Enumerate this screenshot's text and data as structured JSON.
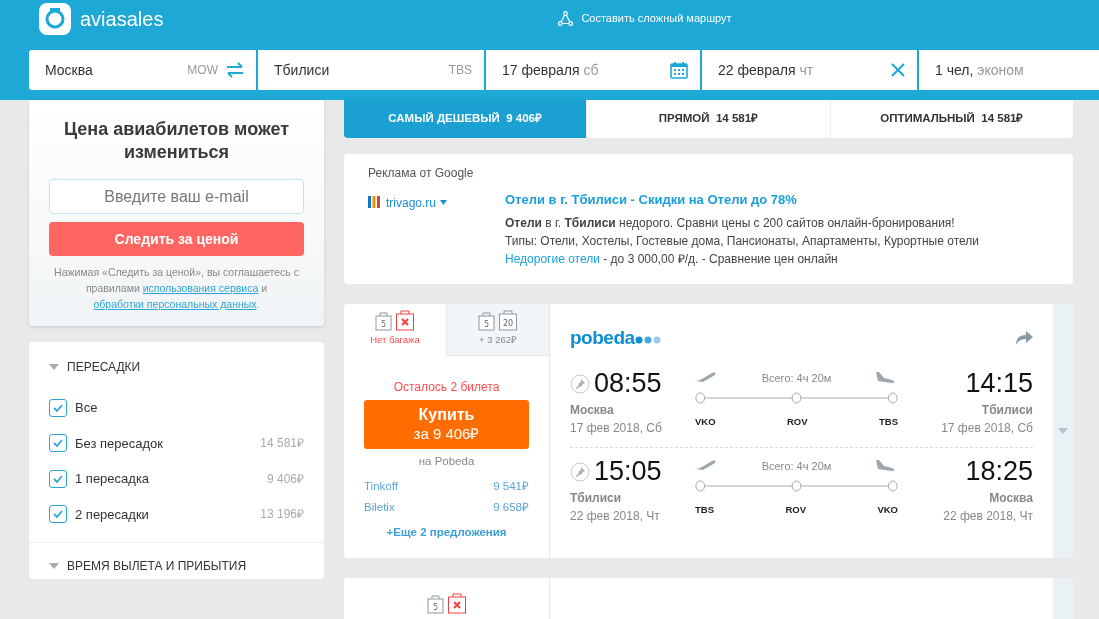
{
  "header": {
    "logo_text": "aviasales",
    "complex_route": "Составить сложный маршрут"
  },
  "search": {
    "origin": {
      "city": "Москва",
      "code": "MOW"
    },
    "destination": {
      "city": "Тбилиси",
      "code": "TBS"
    },
    "depart": {
      "date": "17 февраля",
      "weekday": "сб"
    },
    "return": {
      "date": "22 февраля",
      "weekday": "чт"
    },
    "passengers": {
      "count": "1 чел,",
      "class": "эконом"
    }
  },
  "price_alert": {
    "title": "Цена авиабилетов может измениться",
    "email_placeholder": "Введите ваш e-mail",
    "button": "Следить за ценой",
    "terms_text": "Нажимая «Следить за ценой», вы соглашаетесь с правилами",
    "terms_link_1": "использования сервиса",
    "terms_and": "и",
    "terms_link_2": "обработки персональных данных",
    "terms_end": "."
  },
  "filters": [
    {
      "title": "ПЕРЕСАДКИ",
      "expanded": true,
      "options": [
        {
          "label": "Все",
          "checked": true
        },
        {
          "label": "Без пересадок",
          "checked": true,
          "price": "14 581₽"
        },
        {
          "label": "1 пересадка",
          "checked": true,
          "price": "9 406₽"
        },
        {
          "label": "2 пересадки",
          "checked": true,
          "price": "13 196₽"
        }
      ]
    },
    {
      "title": "ВРЕМЯ ВЫЛЕТА И ПРИБЫТИЯ",
      "expanded": true
    }
  ],
  "sort_tabs": [
    {
      "label": "САМЫЙ ДЕШЕВЫЙ",
      "price": "9 406₽",
      "selected": true
    },
    {
      "label": "ПРЯМОЙ",
      "price": "14 581₽",
      "selected": false
    },
    {
      "label": "ОПТИМАЛЬНЫЙ",
      "price": "14 581₽",
      "selected": false
    }
  ],
  "ad": {
    "label": "Реклама от Google",
    "source": "trivago.ru",
    "title": "Отели в г. Тбилиси - Скидки на Отели до 78%",
    "line_1": "**Отели** в г. **Тбилиси** недорого. Сравни цены с 200 сайтов онлайн-бронирования!",
    "line_2": "Типы: Отели, Хостелы, Гостевые дома, Пансионаты, Апартаменты, Курортные отели",
    "link": "Недорогие отели",
    "link_rest": "- до 3 000,00 ₽/д. - Сравнение цен онлайн"
  },
  "tickets": [
    {
      "baggage_options": [
        {
          "hand": "5",
          "label": "Нет багажа",
          "selected": true
        },
        {
          "hand": "5",
          "luggage": "20",
          "label": "+ 3 262₽",
          "selected": false
        }
      ],
      "seats_left": "Осталось 2 билета",
      "buy": "Купить",
      "price": "за 9 406₽",
      "seller": "на Pobeda",
      "offers": [
        {
          "agency": "Tinkoff",
          "price": "9 541₽"
        },
        {
          "agency": "Biletix",
          "price": "9 658₽"
        }
      ],
      "more_offers": "+Еще 2 предложения",
      "airline": "pobeda",
      "segments": [
        {
          "depart_time": "08:55",
          "depart_city": "Москва",
          "depart_date": "17 фев 2018, Сб",
          "duration": "Всего: 4ч 20м",
          "stops": [
            "VKO",
            "ROV",
            "TBS"
          ],
          "arrive_time": "14:15",
          "arrive_city": "Тбилиси",
          "arrive_date": "17 фев 2018, Сб"
        },
        {
          "depart_time": "15:05",
          "depart_city": "Тбилиси",
          "depart_date": "22 фев 2018, Чт",
          "duration": "Всего: 4ч 20м",
          "stops": [
            "TBS",
            "ROV",
            "VKO"
          ],
          "arrive_time": "18:25",
          "arrive_city": "Москва",
          "arrive_date": "22 фев 2018, Чт"
        }
      ]
    },
    {
      "baggage_options": [
        {
          "hand": "5",
          "selected": true
        }
      ]
    }
  ]
}
